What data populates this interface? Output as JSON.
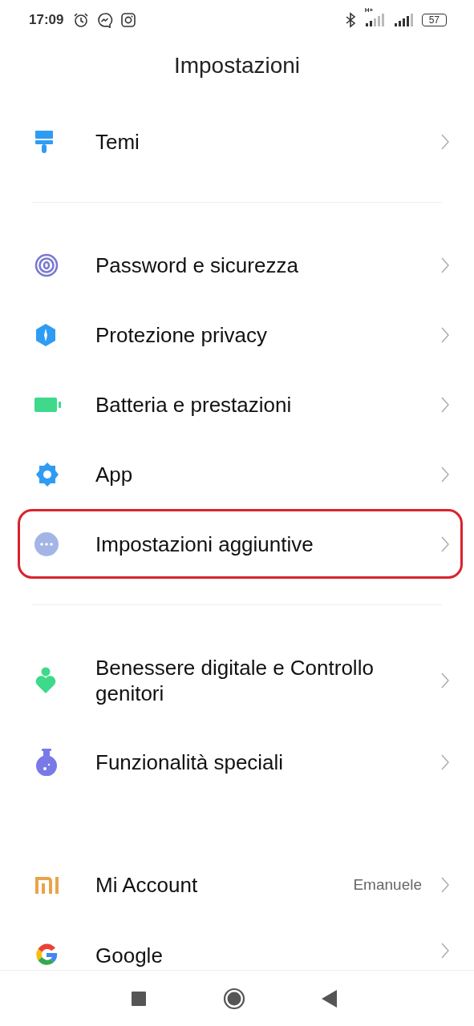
{
  "status_bar": {
    "time": "17:09",
    "network_label": "H+",
    "battery": "57"
  },
  "title": "Impostazioni",
  "sections": [
    {
      "items": [
        {
          "label": "Temi",
          "highlighted": false
        }
      ]
    },
    {
      "items": [
        {
          "label": "Password e sicurezza",
          "highlighted": false
        },
        {
          "label": "Protezione privacy",
          "highlighted": false
        },
        {
          "label": "Batteria e prestazioni",
          "highlighted": false
        },
        {
          "label": "App",
          "highlighted": false
        },
        {
          "label": "Impostazioni aggiuntive",
          "highlighted": true
        }
      ]
    },
    {
      "items": [
        {
          "label": "Benessere digitale e Controllo genitori",
          "highlighted": false
        },
        {
          "label": "Funzionalità speciali",
          "highlighted": false
        }
      ]
    },
    {
      "items": [
        {
          "label": "Mi Account",
          "value": "Emanuele",
          "highlighted": false
        },
        {
          "label": "Google",
          "highlighted": false
        }
      ]
    }
  ]
}
